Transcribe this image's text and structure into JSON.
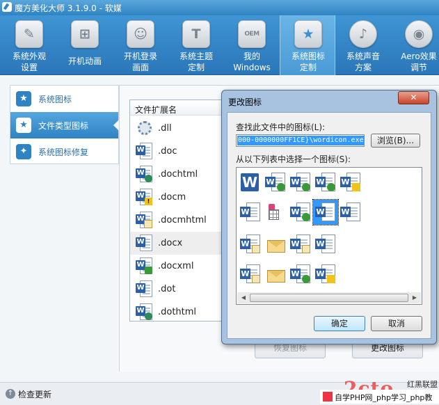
{
  "window": {
    "title": "魔方美化大师 3.1.9.0 - 软媒"
  },
  "toolbar": {
    "items": [
      {
        "label": "系统外观\n设置",
        "icon": "brush-icon",
        "glyph": "✎"
      },
      {
        "label": "开机动画",
        "icon": "windows-logo-icon",
        "glyph": "⊞"
      },
      {
        "label": "开机登录\n画面",
        "icon": "user-login-icon",
        "glyph": "☺"
      },
      {
        "label": "系统主题\n定制",
        "icon": "tshirt-icon",
        "glyph": "T"
      },
      {
        "label": "我的\nWindows",
        "icon": "oem-icon",
        "glyph": "OEM"
      },
      {
        "label": "系统图标\n定制",
        "icon": "star-icon",
        "glyph": "★"
      },
      {
        "label": "系统声音\n方案",
        "icon": "music-note-icon",
        "glyph": "♪"
      },
      {
        "label": "Aero效果\n调节",
        "icon": "aero-disc-icon",
        "glyph": "◉"
      }
    ],
    "active_index": 5
  },
  "sidebar": {
    "items": [
      {
        "label": "系统图标",
        "glyph": "★"
      },
      {
        "label": "文件类型图标",
        "glyph": "★"
      },
      {
        "label": "系统图标修复",
        "glyph": "✦"
      }
    ],
    "active_index": 1
  },
  "file_list": {
    "header": "文件扩展名",
    "rows": [
      {
        "name": ".dll",
        "icon": "gear"
      },
      {
        "name": ".doc",
        "icon": "word"
      },
      {
        "name": ".dochtml",
        "icon": "word-globe"
      },
      {
        "name": ".docm",
        "icon": "word-warn"
      },
      {
        "name": ".docmhtml",
        "icon": "word-doc"
      },
      {
        "name": ".docx",
        "icon": "word"
      },
      {
        "name": ".docxml",
        "icon": "word-arrow"
      },
      {
        "name": ".dot",
        "icon": "word-lines"
      },
      {
        "name": ".dothtml",
        "icon": "word-globe"
      }
    ],
    "selected_index": 5
  },
  "actions": {
    "restore": "恢复图标",
    "change": "更改图标"
  },
  "status": {
    "check_update": "检查更新"
  },
  "watermark": {
    "logo": "2cto",
    "logo_text": "红黑联盟",
    "bar_text": "自学PHP网_php学习_php教"
  },
  "dialog": {
    "title": "更改图标",
    "close_label": "✕",
    "find_label": "查找此文件中的图标(L):",
    "path_value": "000-0000000FF1CE}\\wordicon.exe",
    "browse_label": "浏览(B)...",
    "select_label": "从以下列表中选择一个图标(S):",
    "ok_label": "确定",
    "cancel_label": "取消",
    "selected_icon": 8
  }
}
